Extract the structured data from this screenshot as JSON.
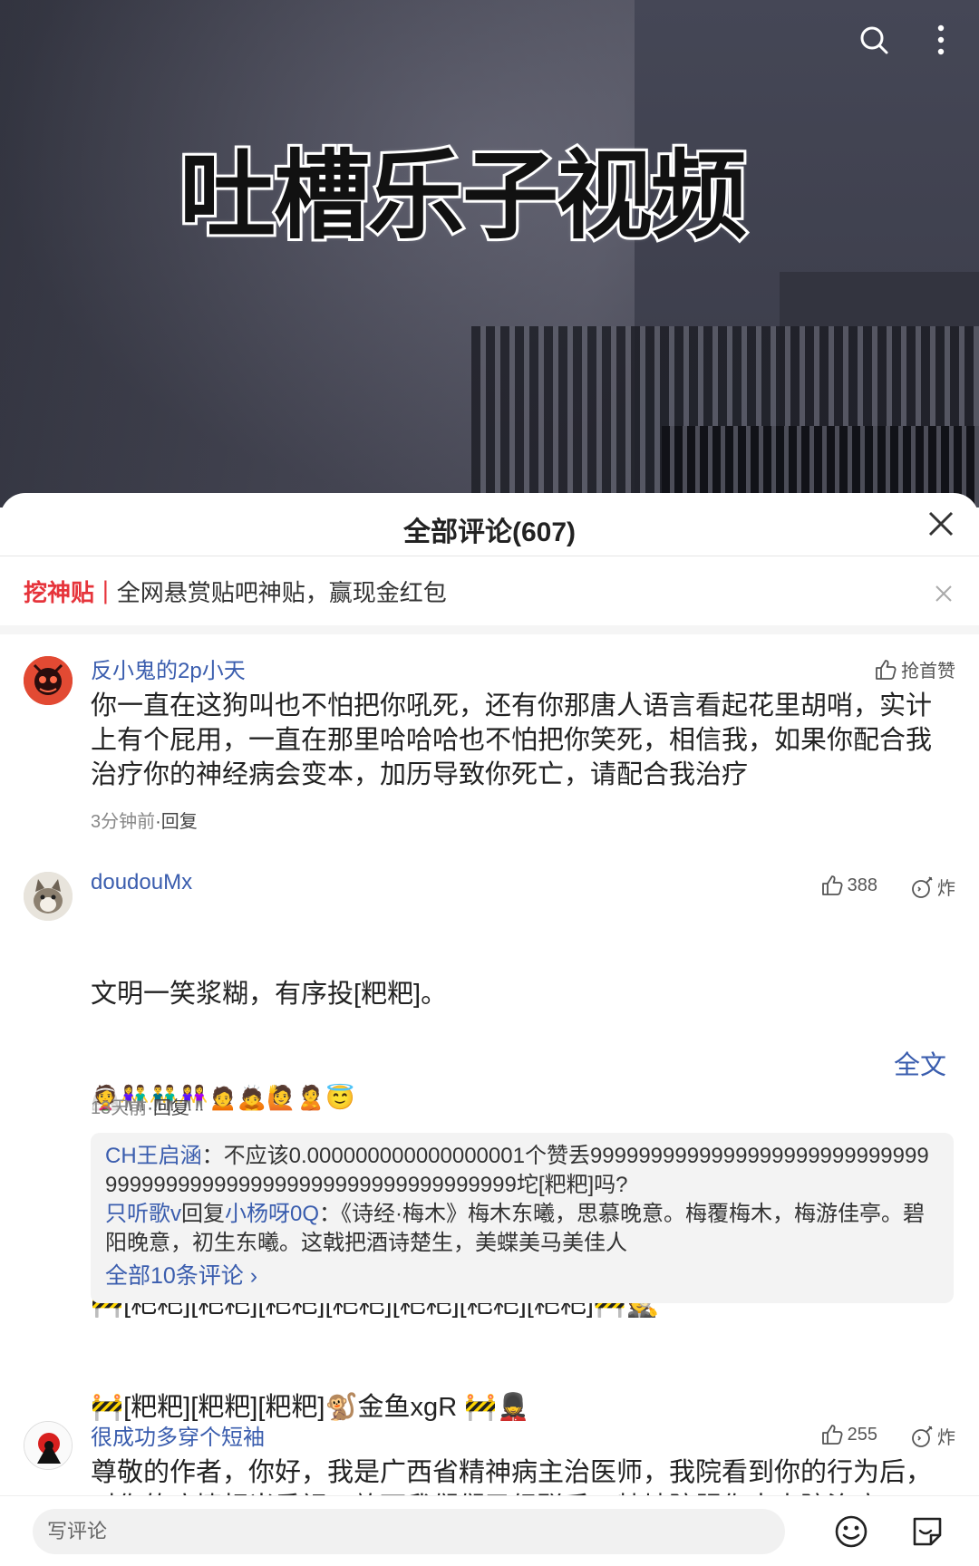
{
  "video": {
    "title": "吐槽乐子视频"
  },
  "sheet": {
    "title": "全部评论(607)"
  },
  "banner": {
    "tag": "挖神贴",
    "separator": "|",
    "text": "全网悬赏贴吧神贴，赢现金红包"
  },
  "comments": [
    {
      "username": "反小鬼的2p小天",
      "text": "你一直在这狗叫也不怕把你吼死，还有你那唐人语言看起花里胡哨，实计上有个屁用，一直在那里哈哈哈也不怕把你笑死，相信我，如果你配合我治疗你的神经病会变本，加历导致你死亡，请配合我治疗",
      "time": "3分钟前",
      "reply_label": "·回复",
      "like_label": "抢首赞"
    },
    {
      "username": "doudouMx",
      "line1": "文明一笑浆糊，有序投[粑粑]。",
      "line2": "👰👫👬👭🙍🙇🙋🙎😇",
      "line3": "🚧🚧🚧🚧🚧🚧🚧🚧🚧🎅",
      "line4": "🚧[粑粑][粑粑][粑粑][粑粑][粑粑][粑粑][粑粑]🚧🕵",
      "line5": "🚧[粑粑][粑粑][粑粑]🐒金鱼xgR 🚧💂",
      "fulltext": "全文",
      "time": "13天前",
      "reply_label": "·回复",
      "likes": "388",
      "bomb_label": "炸",
      "replies": [
        {
          "name": "CH王启涵",
          "text": "：不应该0.000000000000000001个赞丢99999999999999999999999999999999999999999999999999999999999999坨[粑粑]吗?"
        },
        {
          "name": "只听歌v",
          "mid": "回复",
          "to": "小杨呀0Q",
          "text": "：《诗经·梅木》梅木东曦，思慕晚意。梅覆梅木，梅游佳亭。碧阳晚意，初生东曦。这戟把酒诗楚生，美蝶美马美佳人"
        }
      ],
      "more": "全部10条评论 ›"
    },
    {
      "username": "很成功多穿个短袖",
      "text": "尊敬的作者，你好，我是广西省精神病主治医师，我院看到你的行为后，对你的病情相当重视，放下我们们已经联系，特地院服你去本院治疗",
      "likes": "255",
      "bomb_label": "炸"
    }
  ],
  "bottom": {
    "input_placeholder": "写评论"
  },
  "icons": {
    "search": "search-icon",
    "more": "more-vertical-icon",
    "close": "close-icon",
    "like": "thumbs-up-icon",
    "bomb": "bomb-icon",
    "emoji": "emoji-icon",
    "sticker": "sticker-icon"
  },
  "colors": {
    "link": "#3a5dae",
    "accent": "#e6343b"
  }
}
